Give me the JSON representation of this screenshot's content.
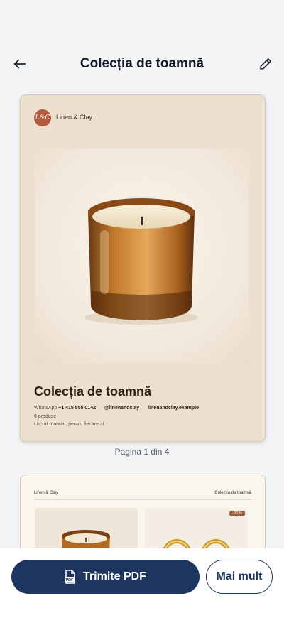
{
  "header": {
    "title": "Colecția de toamnă"
  },
  "page1": {
    "logo_text": "L&C",
    "brand": "Linen & Clay",
    "title": "Colecția de toamnă",
    "whatsapp_label": "WhatsApp",
    "whatsapp_number": "+1 415 555 0142",
    "instagram": "@linenandclay",
    "website": "linenandclay.example",
    "product_count": "6 produse",
    "tagline": "Lucrat manual, pentru fiecare zi"
  },
  "pager": {
    "text": "Pagina 1 din 4"
  },
  "page2": {
    "brand": "Linen & Clay",
    "title": "Colecția de toamnă",
    "discount": "-21%"
  },
  "actions": {
    "send_label": "Trimite PDF",
    "more_label": "Mai mult"
  },
  "colors": {
    "primary": "#1d3660",
    "page_bg": "#ede0cf",
    "logo": "#b4593e"
  }
}
